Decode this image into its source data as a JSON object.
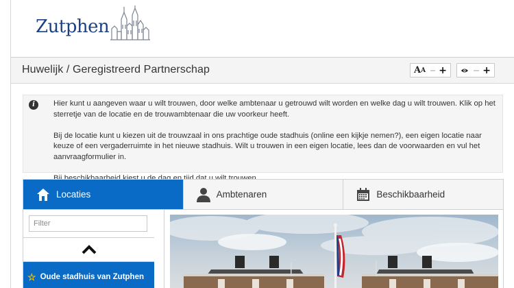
{
  "header": {
    "logo_text": "Zutphen"
  },
  "titlebar": {
    "title": "Huwelijk / Geregistreerd Partnerschap",
    "font_control": {
      "big": "A",
      "small": "A"
    }
  },
  "info": {
    "paragraphs": [
      "Hier kunt u aangeven waar u wilt trouwen, door welke ambtenaar u getrouwd wilt worden en welke dag u wilt trouwen. Klik op het sterretje van de locatie en de trouwambtenaar die uw voorkeur heeft.",
      "Bij de locatie kunt u kiezen uit de trouwzaal in ons prachtige oude stadhuis (online een kijkje nemen?), een eigen locatie naar keuze of een vergaderruimte in het nieuwe stadhuis. Wilt u trouwen in een eigen locatie, lees dan de voorwaarden en vul het aanvraagformulier in.",
      "Bij beschikbaarheid kiest u de dag en tijd dat u wilt trouwen."
    ]
  },
  "tabs": [
    {
      "label": "Locaties",
      "active": true,
      "icon": "home-icon"
    },
    {
      "label": "Ambtenaren",
      "active": false,
      "icon": "person-icon"
    },
    {
      "label": "Beschikbaarheid",
      "active": false,
      "icon": "calendar-icon"
    }
  ],
  "left_panel": {
    "filter_placeholder": "Filter",
    "items": [
      {
        "label": "Oude stadhuis van Zutphen",
        "selected": true,
        "starred": true
      }
    ]
  },
  "colors": {
    "accent": "#0a6bc7",
    "logo": "#1d3f86",
    "star": "#f3c400"
  }
}
